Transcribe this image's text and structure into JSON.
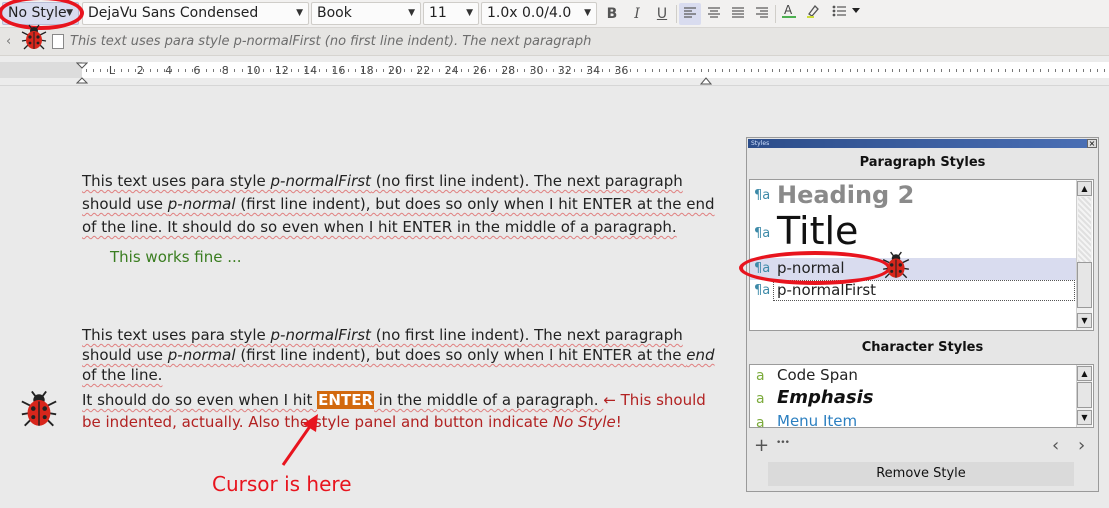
{
  "toolbar": {
    "para_style": "No Style",
    "font_family": "DejaVu Sans Condensed",
    "font_style": "Book",
    "font_size": "11",
    "spacing": "1.0x 0.0/4.0",
    "bold": "B",
    "italic": "I",
    "underline": "U"
  },
  "infobar": {
    "text": "This text uses para style p-normalFirst (no first line indent). The next paragraph"
  },
  "ruler": {
    "labels": [
      "L",
      "2",
      "4",
      "6",
      "8",
      "10",
      "12",
      "14",
      "16",
      "18",
      "20",
      "22",
      "24",
      "26",
      "28",
      "30",
      "32",
      "34",
      "36"
    ]
  },
  "doc": {
    "p1": {
      "a": "This text uses para style ",
      "b": "p-normalFirst",
      "c": " (no first line indent). The next paragraph",
      "d": "should use ",
      "e": "p-normal",
      "f": " (first line indent), but does so only when I hit ENTER at the end",
      "g": "of the line. It should do so even when I hit ENTER in the middle of a paragraph."
    },
    "works": "This works fine ...",
    "p2": {
      "a": "This text uses para style ",
      "b": "p-normalFirst",
      "c": " (no first line indent). The next paragraph",
      "d": "should use ",
      "e": "p-normal",
      "f": " (first line indent), but does so only when I hit ENTER at the ",
      "g": "end",
      "h": "of the line."
    },
    "p3": {
      "a": "It should do so even when I hit ",
      "enter": "ENTER",
      "b": " in the middle of a paragraph. ",
      "c": "← This should",
      "d": "be indented, actually. Also the style panel and button indicate ",
      "e": "No Style",
      "f": "!"
    },
    "cursor_note": "Cursor is here"
  },
  "panel": {
    "title": "Styles",
    "para_header": "Paragraph Styles",
    "para_items": [
      "Heading 2",
      "Title",
      "p-normal",
      "p-normalFirst"
    ],
    "char_header": "Character Styles",
    "char_items": [
      "Code Span",
      "Emphasis",
      "Menu Item"
    ],
    "add": "+",
    "more": "•••",
    "remove": "Remove Style"
  }
}
